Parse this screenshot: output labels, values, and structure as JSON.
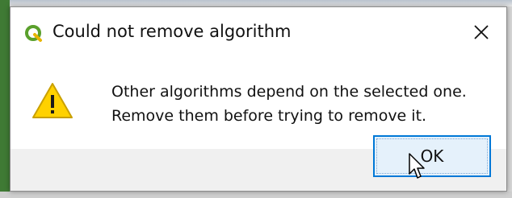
{
  "dialog": {
    "title": "Could not remove algorithm",
    "message_line1": "Other algorithms depend on the selected one.",
    "message_line2": "Remove them before trying to remove it.",
    "ok_label": "OK"
  },
  "icons": {
    "app": "qgis-logo-icon",
    "close": "close-icon",
    "warning": "warning-icon",
    "cursor": "mouse-pointer-icon"
  },
  "colors": {
    "warning_fill": "#FFD100",
    "warning_stroke": "#C9A000",
    "qgis_green": "#5AA02C",
    "button_focus": "#0078D7"
  }
}
